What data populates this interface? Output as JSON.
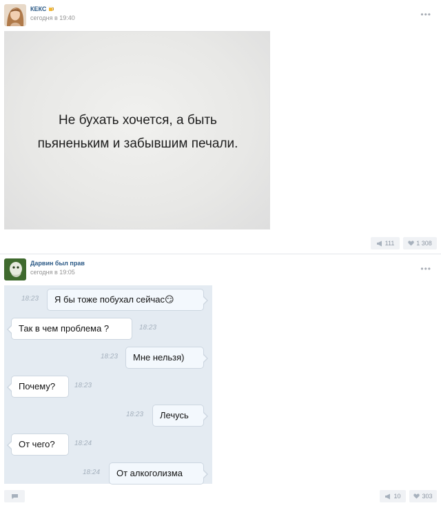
{
  "post1": {
    "author": "КЕКС",
    "author_badge_icon": "beer-mug-icon",
    "timestamp": "сегодня в 19:40",
    "more_icon": "more-dots-icon",
    "image_text_line1": "Не бухать хочется, а быть",
    "image_text_line2": "пьяненьким и забывшим печали.",
    "reposts": "111",
    "likes": "1 308"
  },
  "post2": {
    "author": "Дарвин был прав",
    "timestamp": "сегодня в 19:05",
    "more_icon": "more-dots-icon",
    "chat": [
      {
        "side": "me",
        "text": "Я бы тоже побухал сейчас😏",
        "time": "18:23"
      },
      {
        "side": "them",
        "text": "Так в чем проблема ?",
        "time": "18:23"
      },
      {
        "side": "me",
        "text": "Мне нельзя)",
        "time": "18:23"
      },
      {
        "side": "them",
        "text": "Почему?",
        "time": "18:23"
      },
      {
        "side": "me",
        "text": "Лечусь",
        "time": "18:23"
      },
      {
        "side": "them",
        "text": "От чего?",
        "time": "18:24"
      },
      {
        "side": "me",
        "text": "От алкоголизма",
        "time": "18:24"
      }
    ],
    "reposts": "10",
    "likes": "303"
  },
  "colors": {
    "link": "#2a5885",
    "meta": "#939393",
    "action_bg": "#f0f2f5",
    "chat_bg": "#e4ebf2"
  }
}
